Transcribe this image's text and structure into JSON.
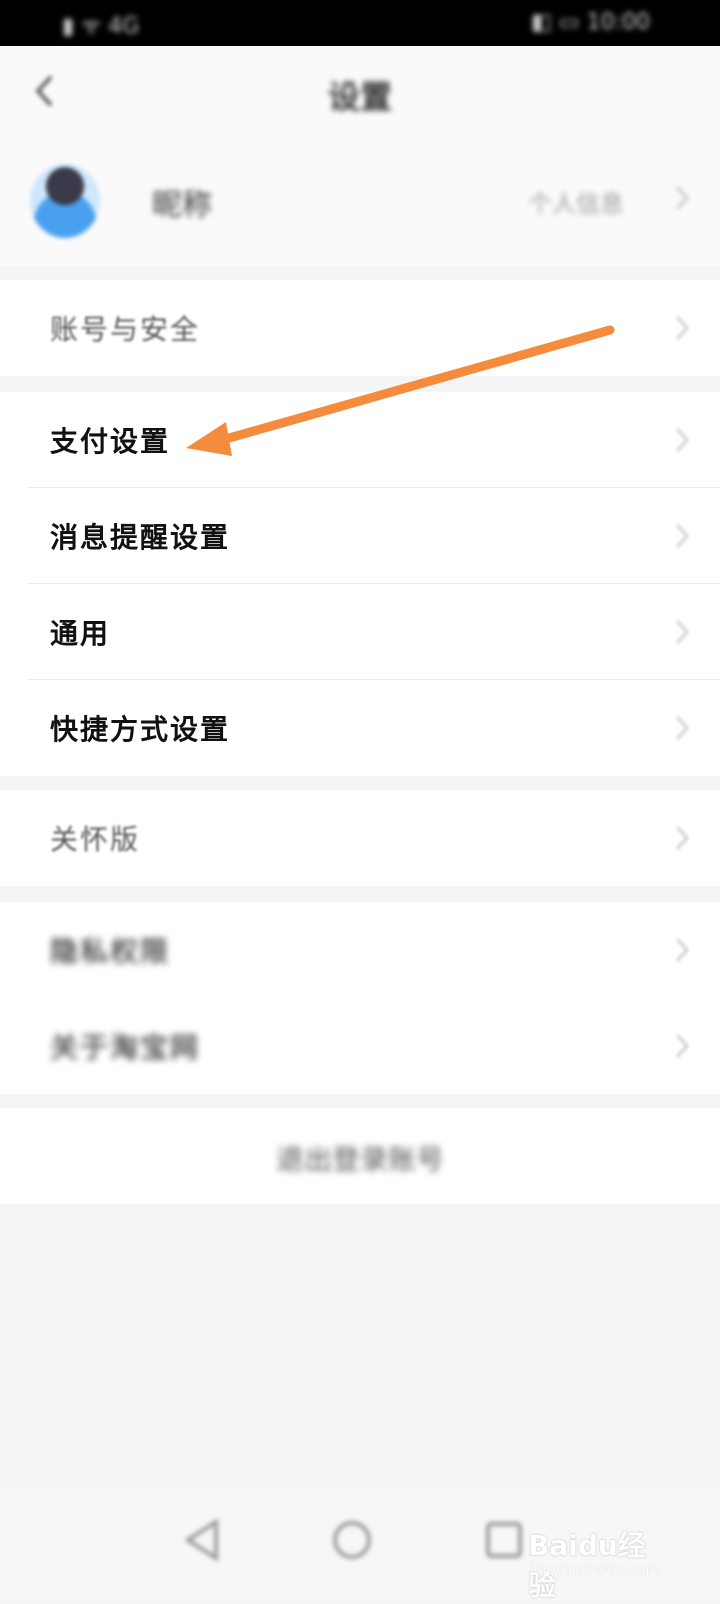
{
  "status_bar": {
    "left_text": "▮ ᯤ 4G",
    "right_text": "◧ ▭ 10:00"
  },
  "nav": {
    "title": "设置"
  },
  "profile": {
    "name": "昵称",
    "hint": "个人信息"
  },
  "groups": [
    {
      "items": [
        {
          "label": "账号与安全"
        }
      ]
    },
    {
      "items": [
        {
          "label": "支付设置"
        },
        {
          "label": "消息提醒设置"
        },
        {
          "label": "通用"
        },
        {
          "label": "快捷方式设置"
        }
      ]
    },
    {
      "items": [
        {
          "label": "关怀版"
        }
      ]
    },
    {
      "items": [
        {
          "label": "隐私权限"
        },
        {
          "label": "关于淘宝网"
        }
      ]
    }
  ],
  "logout": {
    "label": "退出登录账号"
  },
  "watermark": {
    "text": "Baidu经验",
    "sub": "jingyan.baidu.com"
  },
  "colors": {
    "arrow": "#f58b3c",
    "background": "#f4f5f7"
  },
  "icons": {
    "back": "chevron-left-icon",
    "row": "chevron-right-icon"
  }
}
